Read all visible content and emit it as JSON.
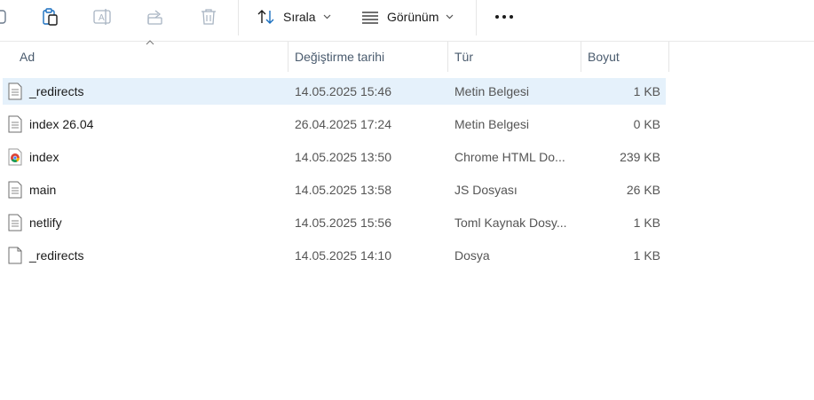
{
  "toolbar": {
    "icons": [
      "new-icon",
      "paste-icon",
      "rename-icon",
      "share-icon",
      "delete-icon"
    ],
    "sort_label": "Sırala",
    "view_label": "Görünüm"
  },
  "columns": {
    "name": "Ad",
    "date": "Değiştirme tarihi",
    "type": "Tür",
    "size": "Boyut"
  },
  "files": [
    {
      "name": "_redirects",
      "date": "14.05.2025 15:46",
      "type": "Metin Belgesi",
      "size": "1 KB",
      "icon": "text-file-icon",
      "selected": true
    },
    {
      "name": "index 26.04",
      "date": "26.04.2025 17:24",
      "type": "Metin Belgesi",
      "size": "0 KB",
      "icon": "text-file-icon",
      "selected": false
    },
    {
      "name": "index",
      "date": "14.05.2025 13:50",
      "type": "Chrome HTML Do...",
      "size": "239 KB",
      "icon": "chrome-file-icon",
      "selected": false
    },
    {
      "name": "main",
      "date": "14.05.2025 13:58",
      "type": "JS Dosyası",
      "size": "26 KB",
      "icon": "text-file-icon",
      "selected": false
    },
    {
      "name": "netlify",
      "date": "14.05.2025 15:56",
      "type": "Toml Kaynak Dosy...",
      "size": "1 KB",
      "icon": "text-file-icon",
      "selected": false
    },
    {
      "name": "_redirects",
      "date": "14.05.2025 14:10",
      "type": "Dosya",
      "size": "1 KB",
      "icon": "blank-file-icon",
      "selected": false
    }
  ],
  "colors": {
    "selected_row": "#e5f1fb",
    "header_text": "#4a5b6e",
    "disabled_icon": "#a8b4c2",
    "accent": "#1a6fbf"
  }
}
